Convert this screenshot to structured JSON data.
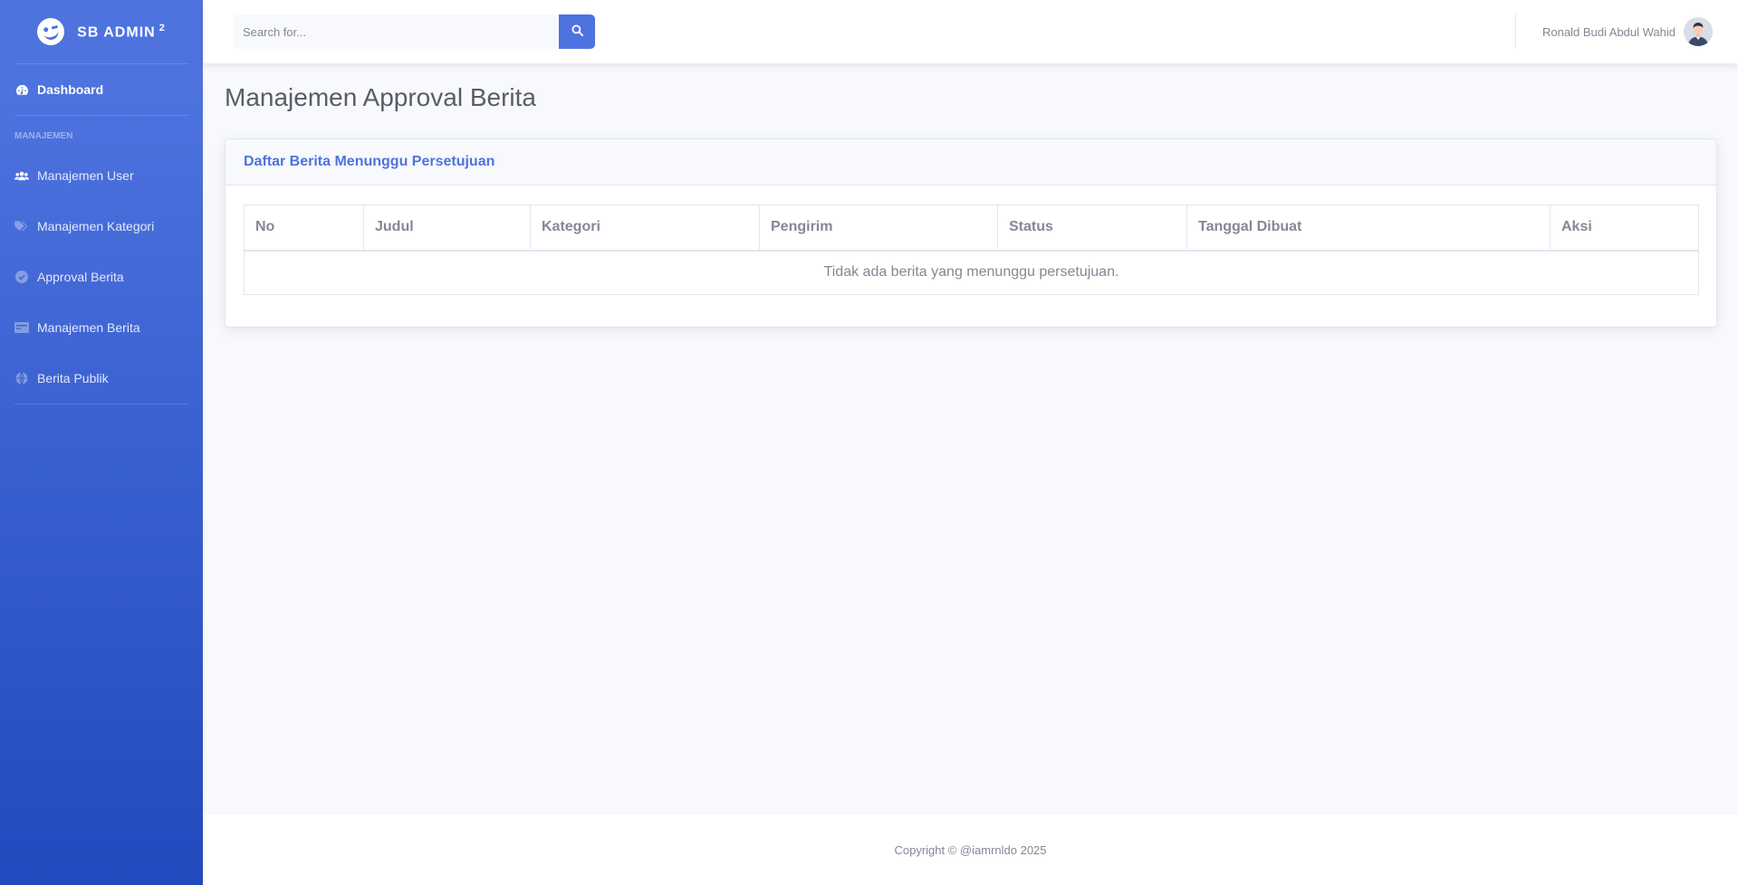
{
  "brand": {
    "name": "SB ADMIN",
    "sup": "2"
  },
  "sidebar": {
    "dashboard": "Dashboard",
    "heading": "MANAJEMEN",
    "items": [
      {
        "label": "Manajemen User",
        "icon": "users-icon"
      },
      {
        "label": "Manajemen Kategori",
        "icon": "tags-icon"
      },
      {
        "label": "Approval Berita",
        "icon": "check-circle-icon"
      },
      {
        "label": "Manajemen Berita",
        "icon": "newspaper-icon"
      },
      {
        "label": "Berita Publik",
        "icon": "globe-icon"
      }
    ]
  },
  "topbar": {
    "search_placeholder": "Search for...",
    "user_name": "Ronald Budi Abdul Wahid"
  },
  "page": {
    "title": "Manajemen Approval Berita",
    "card_title": "Daftar Berita Menunggu Persetujuan",
    "table": {
      "columns": [
        "No",
        "Judul",
        "Kategori",
        "Pengirim",
        "Status",
        "Tanggal Dibuat",
        "Aksi"
      ],
      "empty_message": "Tidak ada berita yang menunggu persetujuan."
    }
  },
  "footer": {
    "copyright": "Copyright © @iamrnldo 2025"
  },
  "colors": {
    "primary": "#4e73df",
    "sidebar_end": "#224abe",
    "text": "#858796"
  }
}
